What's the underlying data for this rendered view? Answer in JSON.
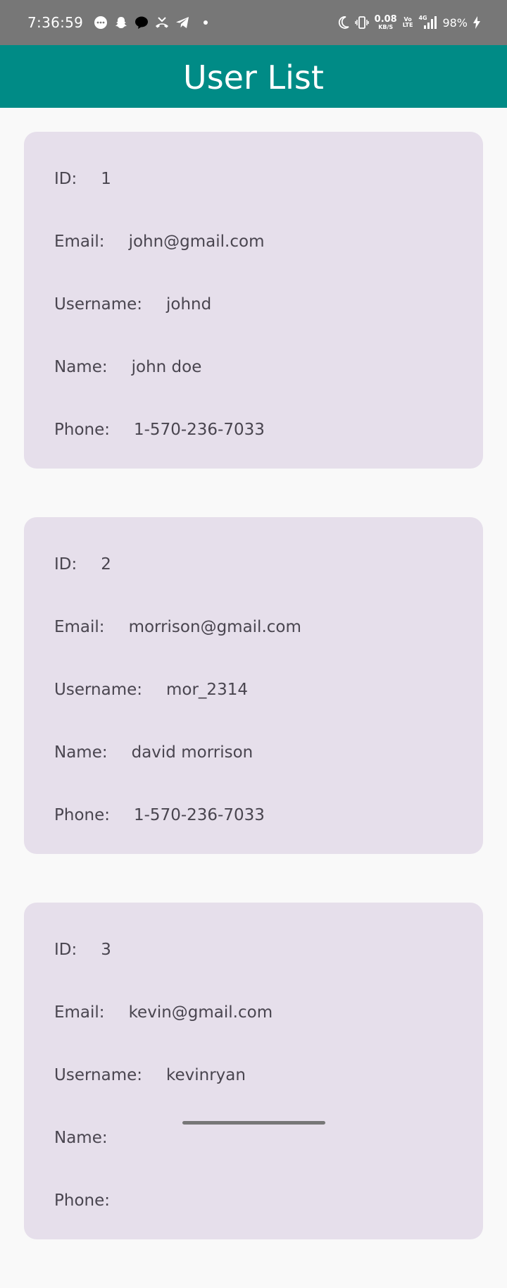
{
  "status_bar": {
    "time": "7:36:59",
    "notification_icons": [
      "chat-bubble-icon",
      "snapchat-icon",
      "messenger-icon",
      "missed-call-icon",
      "telegram-icon"
    ],
    "network_speed_value": "0.08",
    "network_speed_unit": "KB/S",
    "volte_top": "Vo",
    "volte_bottom": "LTE",
    "network_type": "4G",
    "battery": "98%"
  },
  "app_bar": {
    "title": "User List",
    "color": "#008b86"
  },
  "users": [
    {
      "id_label": "ID:",
      "id": "1",
      "email_label": "Email:",
      "email": "john@gmail.com",
      "username_label": "Username:",
      "username": "johnd",
      "name_label": "Name:",
      "name": "john doe",
      "phone_label": "Phone:",
      "phone": "1-570-236-7033"
    },
    {
      "id_label": "ID:",
      "id": "2",
      "email_label": "Email:",
      "email": "morrison@gmail.com",
      "username_label": "Username:",
      "username": "mor_2314",
      "name_label": "Name:",
      "name": "david morrison",
      "phone_label": "Phone:",
      "phone": "1-570-236-7033"
    },
    {
      "id_label": "ID:",
      "id": "3",
      "email_label": "Email:",
      "email": "kevin@gmail.com",
      "username_label": "Username:",
      "username": "kevinryan",
      "name_label": "Name:",
      "name": "",
      "phone_label": "Phone:",
      "phone": ""
    }
  ],
  "colors": {
    "card_background": "#e6dfeb",
    "text": "#49454f",
    "page_background": "#f9f9f9",
    "status_bar": "#777777"
  }
}
